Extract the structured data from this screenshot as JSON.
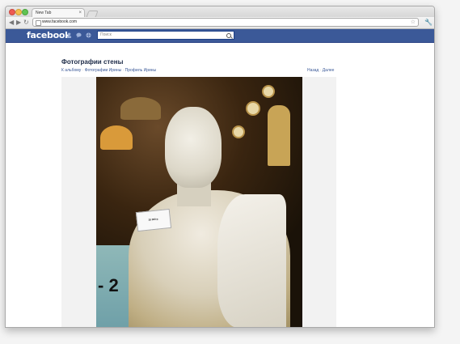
{
  "browser": {
    "tab_title": "New Tab",
    "tab_close": "×",
    "url": "www.facebook.com",
    "back": "◀",
    "forward": "▶",
    "reload": "↻",
    "star": "☆",
    "wrench": "🔧"
  },
  "facebook": {
    "logo": "facebook",
    "search_placeholder": "Поиск",
    "brand_color": "#3b5998"
  },
  "page": {
    "title": "Фотографии стены",
    "breadcrumbs": [
      "К альбому",
      "Фотографии Ирины",
      "Профиль Ирины"
    ],
    "pager": {
      "prev": "Назад",
      "next": "Далее"
    }
  },
  "photo": {
    "price_tag": "20 000 р.",
    "big_digit": "- 2"
  }
}
